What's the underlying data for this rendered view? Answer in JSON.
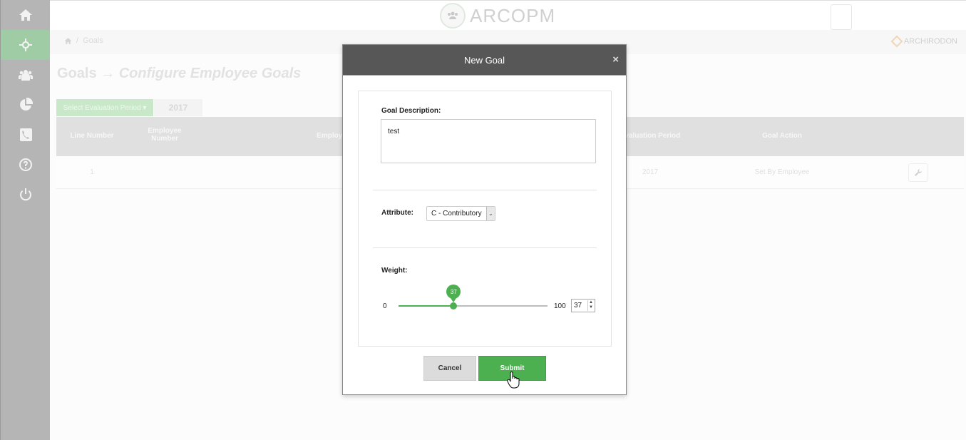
{
  "app": {
    "name": "ARCOPM",
    "brand": "ARCHIRODON"
  },
  "sidebar": {
    "items": [
      {
        "icon": "home-icon"
      },
      {
        "icon": "crosshair-icon",
        "active": true
      },
      {
        "icon": "users-icon"
      },
      {
        "icon": "pie-chart-icon"
      },
      {
        "icon": "phone-icon"
      },
      {
        "icon": "help-icon"
      },
      {
        "icon": "power-icon"
      }
    ]
  },
  "breadcrumb": {
    "separator": "/",
    "current": "Goals"
  },
  "page": {
    "title": "Goals",
    "arrow": "→",
    "subtitle": "Configure Employee Goals",
    "period_button": "Select Evaluation Period ▾",
    "period_year": "2017"
  },
  "table": {
    "headers": {
      "line_number": "Line Number",
      "employee_number": "Employee Number",
      "employee": "Employe",
      "evaluation_period": "Evaluation Period",
      "goal_action": "Goal Action"
    },
    "rows": [
      {
        "line_number": "1",
        "employee": "",
        "evaluation_period": "2017",
        "goal_action": "Set By Employee"
      }
    ]
  },
  "modal": {
    "title": "New Goal",
    "close_label": "×",
    "goal_description_label": "Goal Description:",
    "goal_description_value": "test",
    "attribute_label": "Attribute:",
    "attribute_value": "C - Contributory",
    "weight_label": "Weight:",
    "weight": {
      "min": "0",
      "max": "100",
      "value": "37",
      "min_num": 0,
      "max_num": 100,
      "value_num": 37
    },
    "cancel_label": "Cancel",
    "submit_label": "Submit"
  },
  "colors": {
    "accent": "#4caf50",
    "sidebar": "#b5b5b5",
    "sidebar_active": "#9fcca4",
    "modal_header": "#575757"
  }
}
